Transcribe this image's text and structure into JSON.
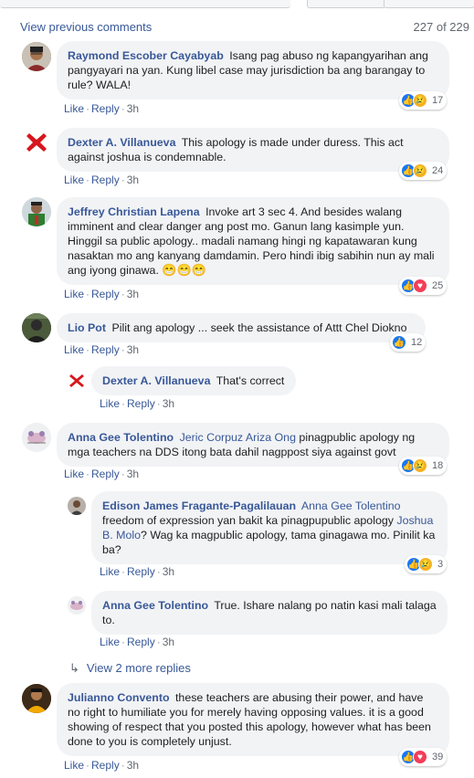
{
  "header": {
    "view_previous": "View previous comments",
    "count": "227 of 229"
  },
  "actions": {
    "like": "Like",
    "reply": "Reply",
    "sep": "·"
  },
  "view_more_replies": "View 2 more replies",
  "comments": [
    {
      "name": "Raymond Escober Cayabyab",
      "text": "Isang pag abuso ng kapangyarihan ang pangyayari na yan. Kung libel case may jurisdiction ba ang barangay to rule? WALA!",
      "time": "3h",
      "reactions": "17"
    },
    {
      "name": "Dexter A. Villanueva",
      "text": "This apology is made under duress. This act against joshua is condemnable.",
      "time": "3h",
      "reactions": "24"
    },
    {
      "name": "Jeffrey Christian Lapena",
      "text": "Invoke art 3 sec 4. And besides walang imminent and clear danger ang post mo. Ganun lang kasimple yun. Hinggil sa public apology.. madali namang hingi ng kapatawaran kung nasaktan mo ang kanyang damdamin. Pero hindi ibig sabihin nun ay mali ang iyong ginawa.",
      "emojis": "😁😁😁",
      "time": "3h",
      "reactions": "25"
    },
    {
      "name": "Lio Pot",
      "text": "Pilit ang apology ... seek the assistance of Attt Chel Diokno",
      "time": "3h",
      "reactions": "12"
    },
    {
      "name": "Dexter A. Villanueva",
      "text": "That's correct",
      "time": "3h"
    },
    {
      "name": "Anna Gee Tolentino",
      "tag": "Jeric Corpuz Ariza Ong",
      "text": "pinagpublic apology ng mga teachers na DDS itong bata dahil nagppost siya against govt",
      "time": "3h",
      "reactions": "18"
    },
    {
      "name": "Edison James Fragante-Pagalilauan",
      "tag": "Anna Gee Tolentino",
      "text1": "freedom of expression yan bakit ka pinagpupublic apology",
      "tag2": "Joshua B. Molo",
      "text2": "? Wag ka magpublic apology, tama ginagawa mo. Pinilit ka ba?",
      "time": "3h",
      "reactions": "3"
    },
    {
      "name": "Anna Gee Tolentino",
      "text": "True. Ishare nalang po natin kasi mali talaga to.",
      "time": "3h"
    },
    {
      "name": "Julianno Convento",
      "text": "these teachers are abusing their power, and have no right to humiliate you for merely having opposing values. it is a good showing of respect that you posted this apology, however what has been done to you is completely unjust.",
      "time": "3h",
      "reactions": "39"
    }
  ],
  "colors": {
    "link": "#385898",
    "bubble": "#f2f3f5",
    "like": "#1877f2",
    "sad": "#f7b125",
    "love": "#f33e58"
  }
}
